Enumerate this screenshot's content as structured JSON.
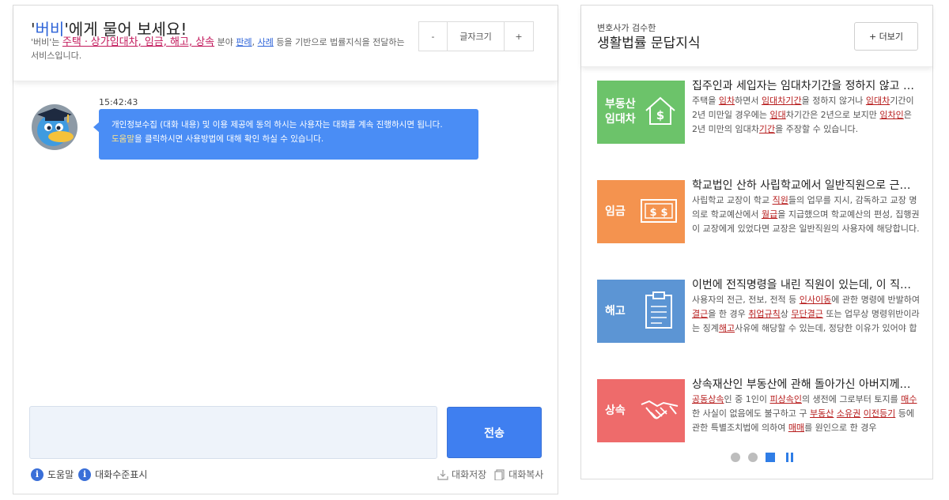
{
  "chat": {
    "title_prefix": "'",
    "title_name": "버비",
    "title_suffix": "'에게 물어 보세요!",
    "desc_part1": "'버비'는 ",
    "desc_fields": "주택ㆍ상가임대차, 임금, 해고, 상속",
    "desc_part2": " 분야 ",
    "desc_link1": "판례",
    "desc_part3": ", ",
    "desc_link2": "사례",
    "desc_part4": " 등을 기반으로 법률지식을 전달하는 서비스입니다.",
    "font_minus": "-",
    "font_label": "글자크기",
    "font_plus": "+",
    "message_time": "15:42:43",
    "message_line1": "개인정보수집 (대화 내용) 및 이용 제공에 동의 하시는 사용자는 대화를 계속 진행하시면 됩니다.",
    "message_help_word": "도움말",
    "message_line2_rest": "을 클릭하시면 사용방법에 대해 확인 하실 수 있습니다.",
    "input_value": "",
    "send_label": "전송",
    "help_label": "도움말",
    "level_label": "대화수준표시",
    "save_label": "대화저장",
    "copy_label": "대화복사"
  },
  "qa": {
    "sub_title": "변호사가 검수한",
    "title": "생활법률 문답지식",
    "more_label": "+ 더보기",
    "items": [
      {
        "category_line1": "부동산",
        "category_line2": "임대차",
        "color": "#6cc36a",
        "icon": "house-dollar-icon",
        "title": "집주인과 세입자는 임대차기간을 정하지 않고 계약할 수 있나요?",
        "body": [
          {
            "t": "주택을 "
          },
          {
            "t": "임차",
            "k": true
          },
          {
            "t": "하면서 "
          },
          {
            "t": "임대차기간",
            "k": true
          },
          {
            "t": "을 정하지 않거나 "
          },
          {
            "t": "임대차",
            "k": true
          },
          {
            "t": "기간이 2년 미만일 경우에는 "
          },
          {
            "t": "임대",
            "k": true
          },
          {
            "t": "차기간은 2년으로 보지만 "
          },
          {
            "t": "임차인",
            "k": true
          },
          {
            "t": "은 2년 미만의 임대차"
          },
          {
            "t": "기간",
            "k": true
          },
          {
            "t": "을 주장할 수 있습니다."
          }
        ]
      },
      {
        "category_line1": "임금",
        "category_line2": "",
        "color": "#f4934f",
        "icon": "money-icon",
        "title": "학교법인 산하 사립학교에서 일반직원으로 근무했는데 임금은 누구에게 청구하나요?",
        "body": [
          {
            "t": "사립학교 교장이 학교 "
          },
          {
            "t": "직원",
            "k": true
          },
          {
            "t": "들의 업무를 지시, 감독하고 교장 명의로 학교예산에서 "
          },
          {
            "t": "월급",
            "k": true
          },
          {
            "t": "을 지급했으며 학교예산의 편성, 집행권이 교장에게 있었다면 교장은 일반직원의 사용자에 해당합니다."
          }
        ]
      },
      {
        "category_line1": "해고",
        "category_line2": "",
        "color": "#5c95d4",
        "icon": "clipboard-icon",
        "title": "이번에 전직명령을 내린 직원이 있는데, 이 직원이 출근하지 않습니다.",
        "body": [
          {
            "t": "사용자의 전근, 전보, 전적 등 "
          },
          {
            "t": "인사이동",
            "k": true
          },
          {
            "t": "에 관한 명령에 반발하여 "
          },
          {
            "t": "결근",
            "k": true
          },
          {
            "t": "을 한 경우 "
          },
          {
            "t": "취업규칙",
            "k": true
          },
          {
            "t": "상 "
          },
          {
            "t": "무단결근",
            "k": true
          },
          {
            "t": " 또는 업무상 명령위반이라는 징계"
          },
          {
            "t": "해고",
            "k": true
          },
          {
            "t": "사유에 해당할 수 있는데, 정당한 이유가 있어야 합니다."
          }
        ]
      },
      {
        "category_line1": "상속",
        "category_line2": "",
        "color": "#ee6b6b",
        "icon": "handshake-icon",
        "title": "상속재산인 부동산에 관해 돌아가신 아버지께서 생전에 매도한 경우",
        "body": [
          {
            "t": "공동상속",
            "k": true
          },
          {
            "t": "인 중 1인이 "
          },
          {
            "t": "피상속인",
            "k": true
          },
          {
            "t": "의 생전에 그로부터 토지를 "
          },
          {
            "t": "매수",
            "k": true
          },
          {
            "t": "한 사실이 없음에도 불구하고 구 "
          },
          {
            "t": "부동산",
            "k": true
          },
          {
            "t": " "
          },
          {
            "t": "소유권",
            "k": true
          },
          {
            "t": " "
          },
          {
            "t": "이전등기",
            "k": true
          },
          {
            "t": " 등에 관한 특별조치법에 의하여 "
          },
          {
            "t": "매매",
            "k": true
          },
          {
            "t": "를 원인으로 한 경우"
          }
        ]
      }
    ]
  },
  "colors": {
    "accent": "#3f7ff0",
    "bubble": "#4a8df5",
    "keyword": "#b71c1c"
  }
}
